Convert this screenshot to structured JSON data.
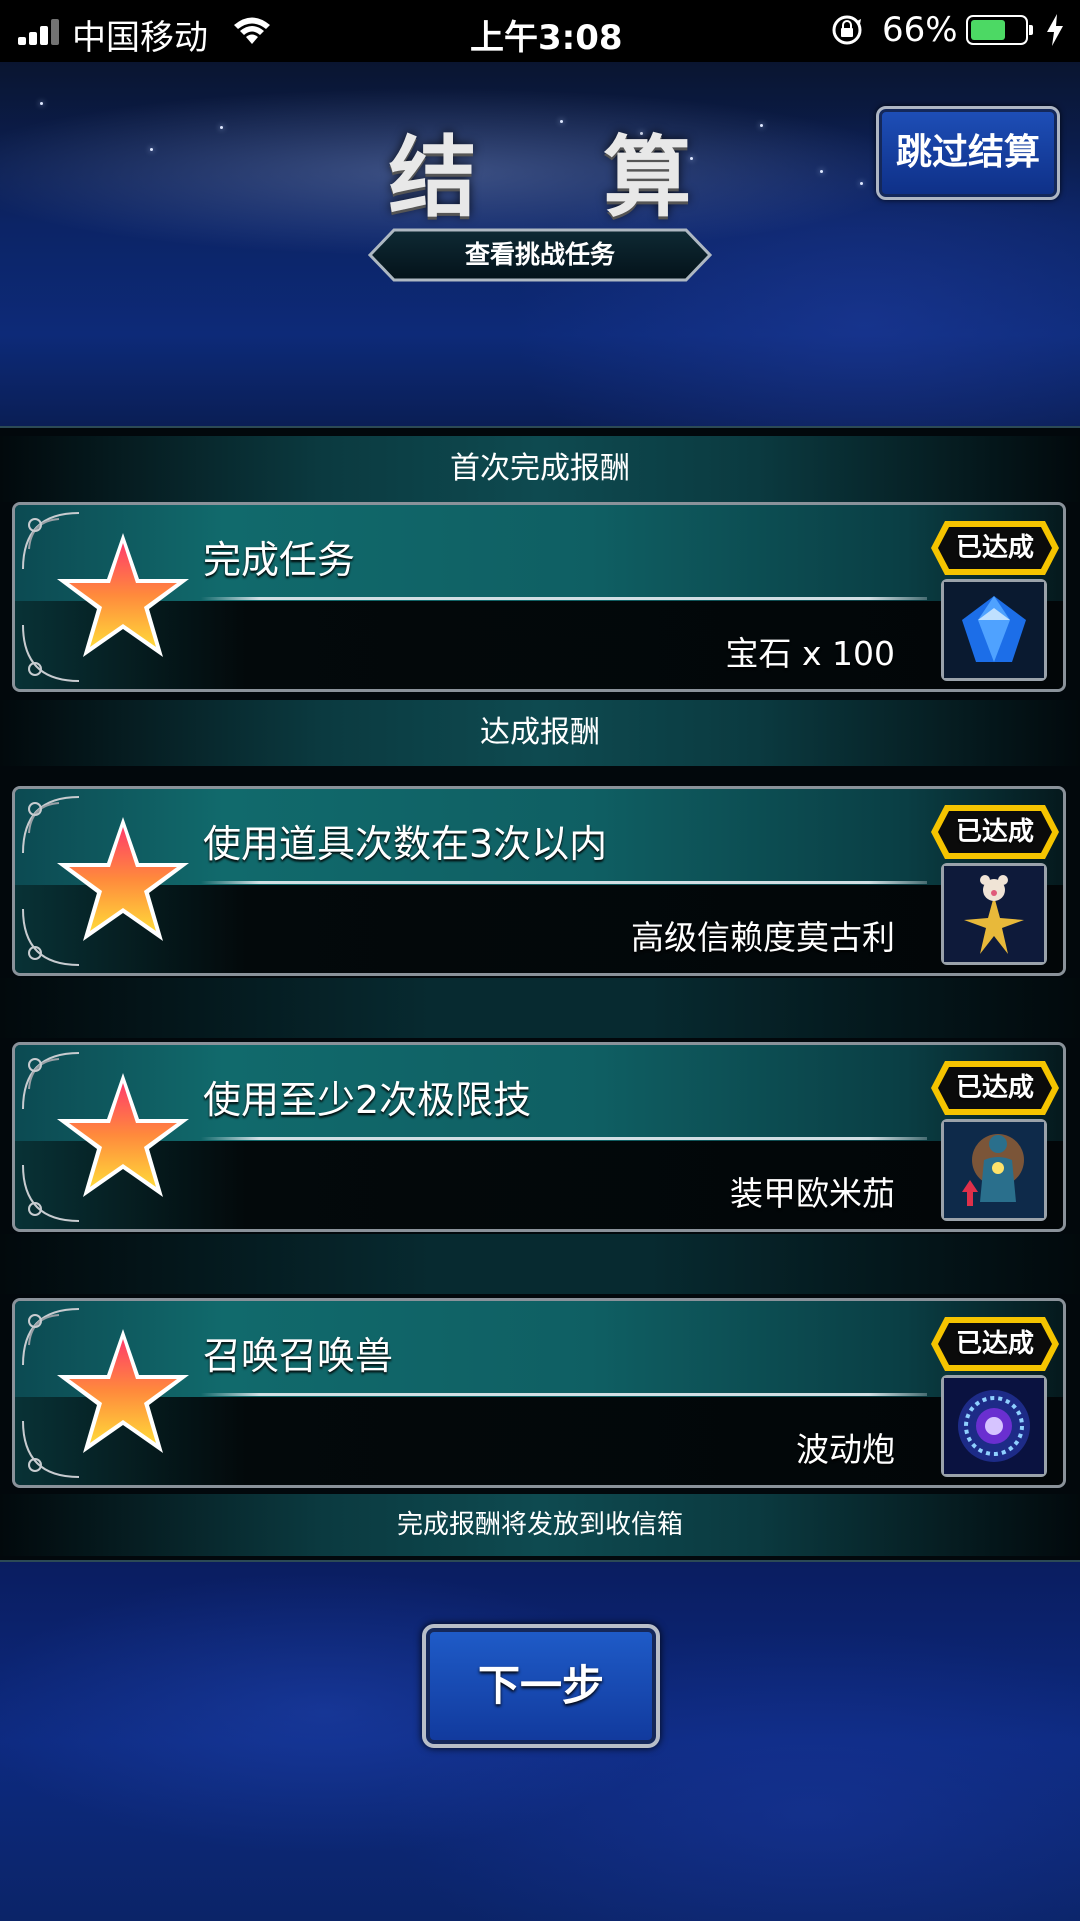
{
  "status_bar": {
    "carrier": "中国移动",
    "time": "上午3:08",
    "battery_percent": "66%",
    "battery_level": 0.66
  },
  "header": {
    "title": "结 算",
    "skip_button": "跳过结算",
    "challenge_tab": "查看挑战任务"
  },
  "sections": {
    "first_clear_heading": "首次完成报酬",
    "achievement_heading": "达成报酬",
    "footer_note": "完成报酬将发放到收信箱"
  },
  "missions": [
    {
      "title": "完成任务",
      "reward": "宝石 x 100",
      "status": "已达成",
      "icon": "gem-icon"
    },
    {
      "title": "使用道具次数在3次以内",
      "reward": "高级信赖度莫古利",
      "status": "已达成",
      "icon": "moogle-star-icon"
    },
    {
      "title": "使用至少2次极限技",
      "reward": "装甲欧米茄",
      "status": "已达成",
      "icon": "armor-boost-icon"
    },
    {
      "title": "召唤召唤兽",
      "reward": "波动炮",
      "status": "已达成",
      "icon": "wave-cannon-icon"
    }
  ],
  "next_button": "下一步",
  "colors": {
    "achieved_gold": "#f5c400",
    "panel_teal": "#116a6c",
    "button_blue": "#1f5cc9"
  }
}
